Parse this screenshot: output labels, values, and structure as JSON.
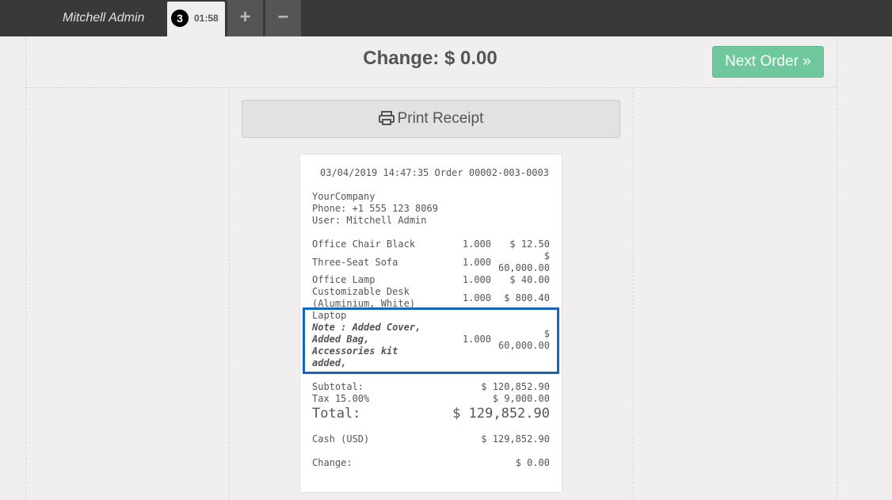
{
  "topbar": {
    "user_name": "Mitchell Admin",
    "order_tab": {
      "number": "3",
      "time": "01:58"
    },
    "add_label": "+",
    "remove_label": "−"
  },
  "header": {
    "change_title": "Change: $ 0.00",
    "next_order_label": "Next Order »"
  },
  "print_button": {
    "label": "Print Receipt"
  },
  "receipt": {
    "header_line": "03/04/2019 14:47:35 Order 00002-003-0003",
    "company": "YourCompany",
    "phone": "Phone: +1 555 123 8069",
    "user": "User: Mitchell Admin",
    "lines": [
      {
        "name": "Office Chair Black",
        "qty": "1.000",
        "price": "$ 12.50"
      },
      {
        "name": "Three-Seat Sofa",
        "qty": "1.000",
        "price_l1": "$",
        "price_l2": "60,000.00"
      },
      {
        "name": "Office Lamp",
        "qty": "1.000",
        "price": "$ 40.00"
      },
      {
        "name_l1": "Customizable Desk",
        "name_l2": "(Aluminium, White)",
        "qty": "1.000",
        "price": "$ 800.40"
      },
      {
        "name": "Laptop",
        "note": [
          "Note : Added Cover,",
          "Added Bag,",
          "Accessories kit",
          "added,"
        ],
        "qty": "1.000",
        "price_l1": "$",
        "price_l2": "60,000.00"
      }
    ],
    "subtotal_label": "Subtotal:",
    "subtotal_value": "$ 120,852.90",
    "tax_label": "Tax 15.00%",
    "tax_value": "$ 9,000.00",
    "total_label": "Total:",
    "total_value": "$ 129,852.90",
    "payment_label": "Cash (USD)",
    "payment_value": "$ 129,852.90",
    "change_label": "Change:",
    "change_value": "$ 0.00"
  },
  "colors": {
    "topbar": "#393939",
    "next_order": "#6ec89b",
    "highlight": "#1565c0"
  }
}
